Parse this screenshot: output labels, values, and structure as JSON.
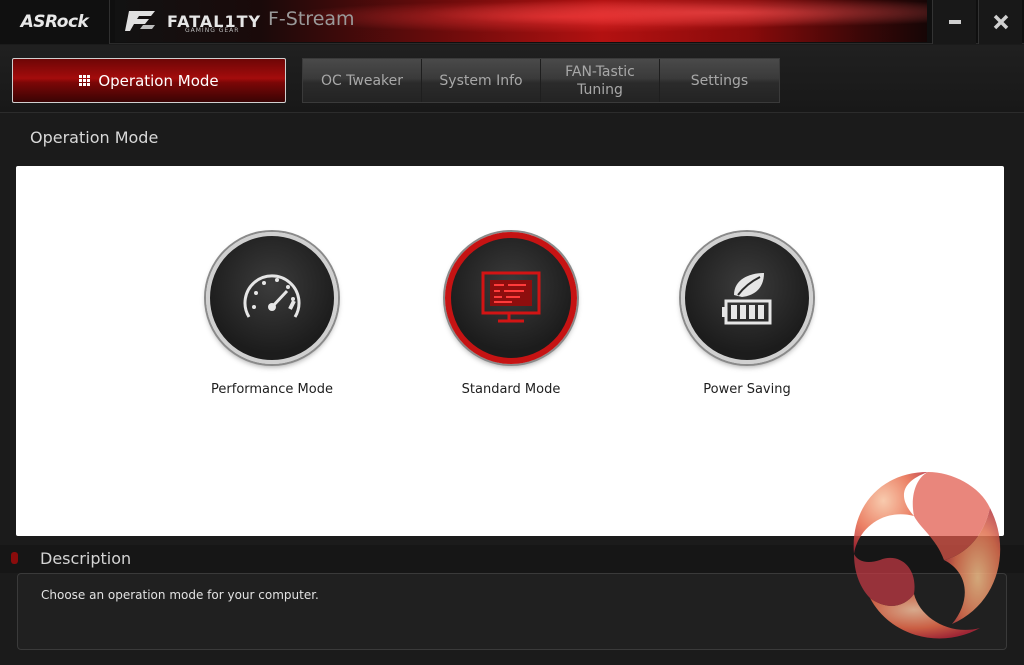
{
  "window": {
    "brand": "ASRock",
    "banner_logo": "FATAL1TY",
    "banner_logo_sub": "GAMING GEAR",
    "app_title": "F-Stream",
    "minimize_icon": "minimize-icon",
    "close_icon": "close-icon"
  },
  "tabs": {
    "active": {
      "label": "Operation Mode",
      "icon": "grid-icon"
    },
    "items": [
      {
        "label": "OC Tweaker"
      },
      {
        "label": "System Info"
      },
      {
        "label": "FAN-Tastic Tuning"
      },
      {
        "label": "Settings"
      }
    ]
  },
  "section": {
    "title": "Operation Mode"
  },
  "modes": [
    {
      "label": "Performance Mode",
      "icon": "speedometer-icon",
      "selected": false
    },
    {
      "label": "Standard Mode",
      "icon": "monitor-icon",
      "selected": true
    },
    {
      "label": "Power Saving",
      "icon": "leaf-battery-icon",
      "selected": false
    }
  ],
  "description": {
    "title": "Description",
    "text": "Choose an operation mode for your computer."
  },
  "colors": {
    "accent": "#c61313",
    "background": "#1b1b1b",
    "panel": "#ffffff"
  }
}
